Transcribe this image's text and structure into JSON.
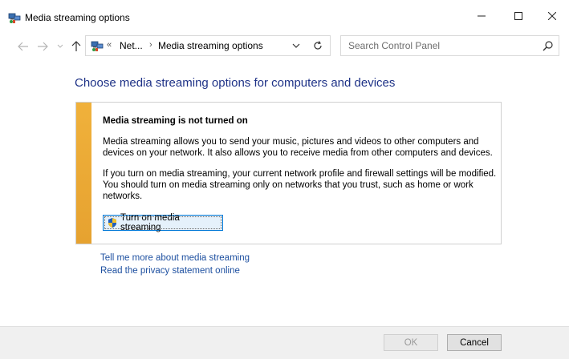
{
  "window": {
    "title": "Media streaming options"
  },
  "address": {
    "overflow_chevron": "«",
    "crumb1": "Net...",
    "separator": "›",
    "crumb2": "Media streaming options"
  },
  "search": {
    "placeholder": "Search Control Panel"
  },
  "heading": "Choose media streaming options for computers and devices",
  "panel": {
    "title": "Media streaming is not turned on",
    "para1": "Media streaming allows you to send your music, pictures and videos to other computers and devices on your network.  It also allows you to receive media from other computers and devices.",
    "para2": "If you turn on media streaming, your current network profile and firewall settings will be modified. You should turn on media streaming only on networks that you trust, such as home or work networks.",
    "button": "Turn on media streaming"
  },
  "links": {
    "more": "Tell me more about media streaming",
    "privacy": "Read the privacy statement online"
  },
  "footer": {
    "ok": "OK",
    "cancel": "Cancel"
  },
  "icons": {
    "app": "network-media-icon",
    "back": "back-arrow-icon",
    "forward": "forward-arrow-icon",
    "up": "up-arrow-icon",
    "refresh": "refresh-icon",
    "search": "search-icon",
    "shield": "uac-shield-icon"
  },
  "colors": {
    "heading": "#1e3287",
    "link": "#1e50a0",
    "stripe": "#f0b13b"
  }
}
